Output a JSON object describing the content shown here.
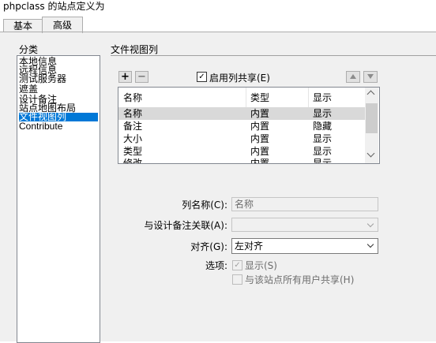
{
  "window": {
    "title": "phpclass 的站点定义为"
  },
  "tabs": [
    {
      "label": "基本"
    },
    {
      "label": "高级"
    }
  ],
  "categories": {
    "label": "分类",
    "items": [
      {
        "label": "本地信息"
      },
      {
        "label": "远程信息"
      },
      {
        "label": "测试服务器"
      },
      {
        "label": "遮盖"
      },
      {
        "label": "设计备注"
      },
      {
        "label": "站点地图布局"
      },
      {
        "label": "文件视图列",
        "selected": true
      },
      {
        "label": "Contribute"
      }
    ]
  },
  "file_view_columns": {
    "title": "文件视图列",
    "add_label": "+",
    "remove_label": "−",
    "enable_share": {
      "label": "启用列共享(E)",
      "checked": true,
      "check_mark": "✓"
    },
    "move_up_icon": "arrow-up-icon",
    "move_down_icon": "arrow-down-icon",
    "table": {
      "headers": [
        "名称",
        "类型",
        "显示"
      ],
      "rows": [
        [
          "名称",
          "内置",
          "显示"
        ],
        [
          "备注",
          "内置",
          "隐藏"
        ],
        [
          "大小",
          "内置",
          "显示"
        ],
        [
          "类型",
          "内置",
          "显示"
        ],
        [
          "修改",
          "内置",
          "显示"
        ]
      ]
    }
  },
  "form": {
    "column_name": {
      "label": "列名称(C):",
      "value": "名称"
    },
    "associate": {
      "label": "与设计备注关联(A):",
      "value": ""
    },
    "align": {
      "label": "对齐(G):",
      "value": "左对齐"
    },
    "options": {
      "label": "选项:",
      "show": {
        "label": "显示(S)",
        "checked": true,
        "check_mark": "✓"
      },
      "share": {
        "label": "与该站点所有用户共享(H)",
        "checked": false
      }
    }
  },
  "colors": {
    "selection": "#0078d7",
    "row_highlight": "#d9d9d9",
    "dialog_bg": "#f0f0f0"
  }
}
